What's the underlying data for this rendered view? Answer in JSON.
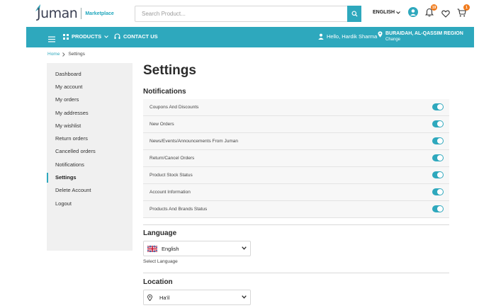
{
  "header": {
    "logo_text": "Juman",
    "logo_sub": "Marketplace",
    "search_placeholder": "Search Product...",
    "language": "ENGLISH",
    "notifications_count": "19",
    "cart_count": "1"
  },
  "nav": {
    "products_label": "PRODUCTS",
    "contact_label": "CONTACT US",
    "greeting": "Hello, Hardik Sharma",
    "location_city": "BURAIDAH, AL-QASSIM REGION",
    "location_change": "Change"
  },
  "breadcrumb": {
    "home": "Home",
    "current": "Settings"
  },
  "sidebar": {
    "items": [
      {
        "label": "Dashboard"
      },
      {
        "label": "My account"
      },
      {
        "label": "My orders"
      },
      {
        "label": "My addresses"
      },
      {
        "label": "My wishlist"
      },
      {
        "label": "Return orders"
      },
      {
        "label": "Cancelled orders"
      },
      {
        "label": "Notifications"
      },
      {
        "label": "Settings"
      },
      {
        "label": "Delete Account"
      },
      {
        "label": "Logout"
      }
    ]
  },
  "main": {
    "title": "Settings",
    "notifications_title": "Notifications",
    "notifications": [
      {
        "label": "Coupons And Discounts",
        "enabled": true
      },
      {
        "label": "New Orders",
        "enabled": true
      },
      {
        "label": "News/Events/Announcements From Juman",
        "enabled": true
      },
      {
        "label": "Return/Cancel Orders",
        "enabled": true
      },
      {
        "label": "Product Stock Status",
        "enabled": true
      },
      {
        "label": "Account Information",
        "enabled": true
      },
      {
        "label": "Products And Brands Status",
        "enabled": true
      }
    ],
    "language_title": "Language",
    "language_value": "English",
    "language_hint": "Select Language",
    "location_title": "Location",
    "location_value": "Ha'il"
  },
  "colors": {
    "accent": "#2ea8bd",
    "badge": "#f07a1b",
    "sidebar_bg": "#f0f0f0"
  }
}
